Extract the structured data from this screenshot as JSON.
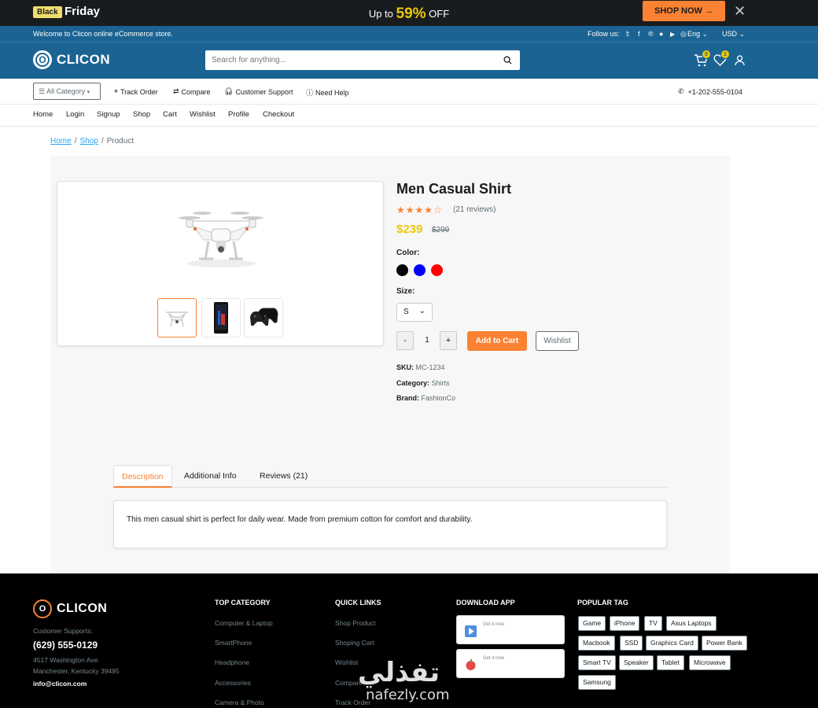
{
  "promo": {
    "black": "Black",
    "friday": "Friday",
    "up_to": "Up to",
    "percent": "59%",
    "off": "OFF",
    "shop_now": "SHOP NOW →",
    "close": "✕"
  },
  "header": {
    "welcome": "Welcome to Clicon online eCommerce store.",
    "follow": "Follow us:",
    "language": "Eng",
    "currency": "USD",
    "brand": "CLICON",
    "search_placeholder": "Search for anything...",
    "cart_count": "0",
    "wishlist_count": "1"
  },
  "subnav": {
    "all_category": "All Category",
    "track_order": "Track Order",
    "compare": "Compare",
    "support": "Customer Support",
    "help": "Need Help",
    "phone": "+1-202-555-0104"
  },
  "nav": [
    "Home",
    "Login",
    "Signup",
    "Shop",
    "Cart",
    "Wishlist",
    "Profile",
    "Checkout"
  ],
  "breadcrumb": [
    "Home",
    "Shop",
    "Product"
  ],
  "product": {
    "title": "Men Casual Shirt",
    "rating": 4,
    "reviews": "(21 reviews)",
    "price": "$239",
    "old_price": "$299",
    "color_label": "Color:",
    "colors": [
      "#000000",
      "#0000ff",
      "#ff0000"
    ],
    "size_label": "Size:",
    "size": "S",
    "qty": "1",
    "minus": "-",
    "plus": "+",
    "add_to_cart": "Add to Cart",
    "wishlist": "Wishlist",
    "sku_label": "SKU:",
    "sku": "MC-1234",
    "category_label": "Category:",
    "category": "Shirts",
    "brand_label": "Brand:",
    "brand": "FashionCo"
  },
  "tabs": [
    "Description",
    "Additional Info",
    "Reviews (21)"
  ],
  "description": "This men casual shirt is perfect for daily wear. Made from premium cotton for comfort and durability.",
  "footer": {
    "brand": "CLICON",
    "support_label": "Customer Supports:",
    "phone": "(629) 555-0129",
    "address1": "4517 Washington Ave.",
    "address2": "Manchester, Kentucky 39495",
    "email": "info@clicon.com",
    "top_category": "TOP CATEGORY",
    "categories": [
      "Computer & Laptop",
      "SmartPhone",
      "Headphone",
      "Accessories",
      "Camera & Photo"
    ],
    "quick_links": "QUICK LINKS",
    "links": [
      "Shop Product",
      "Shoping Cart",
      "Wishlist",
      "Compare",
      "Track Order"
    ],
    "download_app": "DOWNLOAD APP",
    "get_it_now": "Get it now",
    "popular_tag": "POPULAR TAG",
    "tags": [
      [
        "Game",
        "iPhone",
        "TV",
        "Asus Laptops"
      ],
      [
        "Macbook",
        "SSD",
        "Graphics Card",
        "Power Bank"
      ],
      [
        "Smart TV",
        "Speaker",
        "Tablet",
        "Microwave"
      ],
      [
        "Samsung"
      ]
    ]
  },
  "watermark": {
    "arabic": "تفذلي",
    "latin": "nafezly.com"
  }
}
